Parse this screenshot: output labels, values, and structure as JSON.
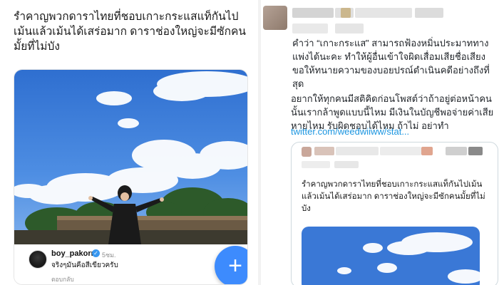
{
  "left": {
    "post_text": "รำคาญพวกดาราไทยที่ชอบเกาะกระแสแท็กันไปเม้นแล้วเม้นได้เสร่อมาก ดาราช่องใหญ่จะมีซักคนมั้ยที่ไม่บัง",
    "comment": {
      "username": "boy_pakorn",
      "verified_mark": "✓",
      "time": "5ชม.",
      "text": "จริงๆมันคือสีเขียวครับ",
      "reply_label": "ตอบกลับ"
    },
    "fab_label": "+"
  },
  "right": {
    "paragraph1": "คำว่า “เกาะกระแส” สามารถฟ้องหมิ่นประมาททางแพ่งได้นะคะ ทำให้ผู้อื่นเข้าใจผิดเสื่อมเสียชื่อเสียง ขอให้ทนายความของบอยปรณ์ดำเนินคดีอย่างถึงที่สุด",
    "paragraph2": "อยากให้ทุกคนมีสติคิดก่อนโพสต์ว่าถ้าอยู่ต่อหน้าคนนั้นเรากล้าพูดแบบนี้ไหม มีเงินในบัญชีพอจ่ายค่าเสียหายไหม รับผิดชอบได้ไหม ถ้าไม่ อย่าทำ",
    "link": "twitter.com/weedwiiww/stat...",
    "quote_text": "รำคาญพวกดาราไทยที่ชอบเกาะกระแสแท็กันไปเม้นแล้วเม้นได้เสร่อมาก ดาราช่องใหญ่จะมีซักคนมั้ยที่ไม่บัง"
  },
  "colors": {
    "link": "#1b95e0",
    "fab": "#3d8bfd",
    "sky": "#3a78d6"
  }
}
